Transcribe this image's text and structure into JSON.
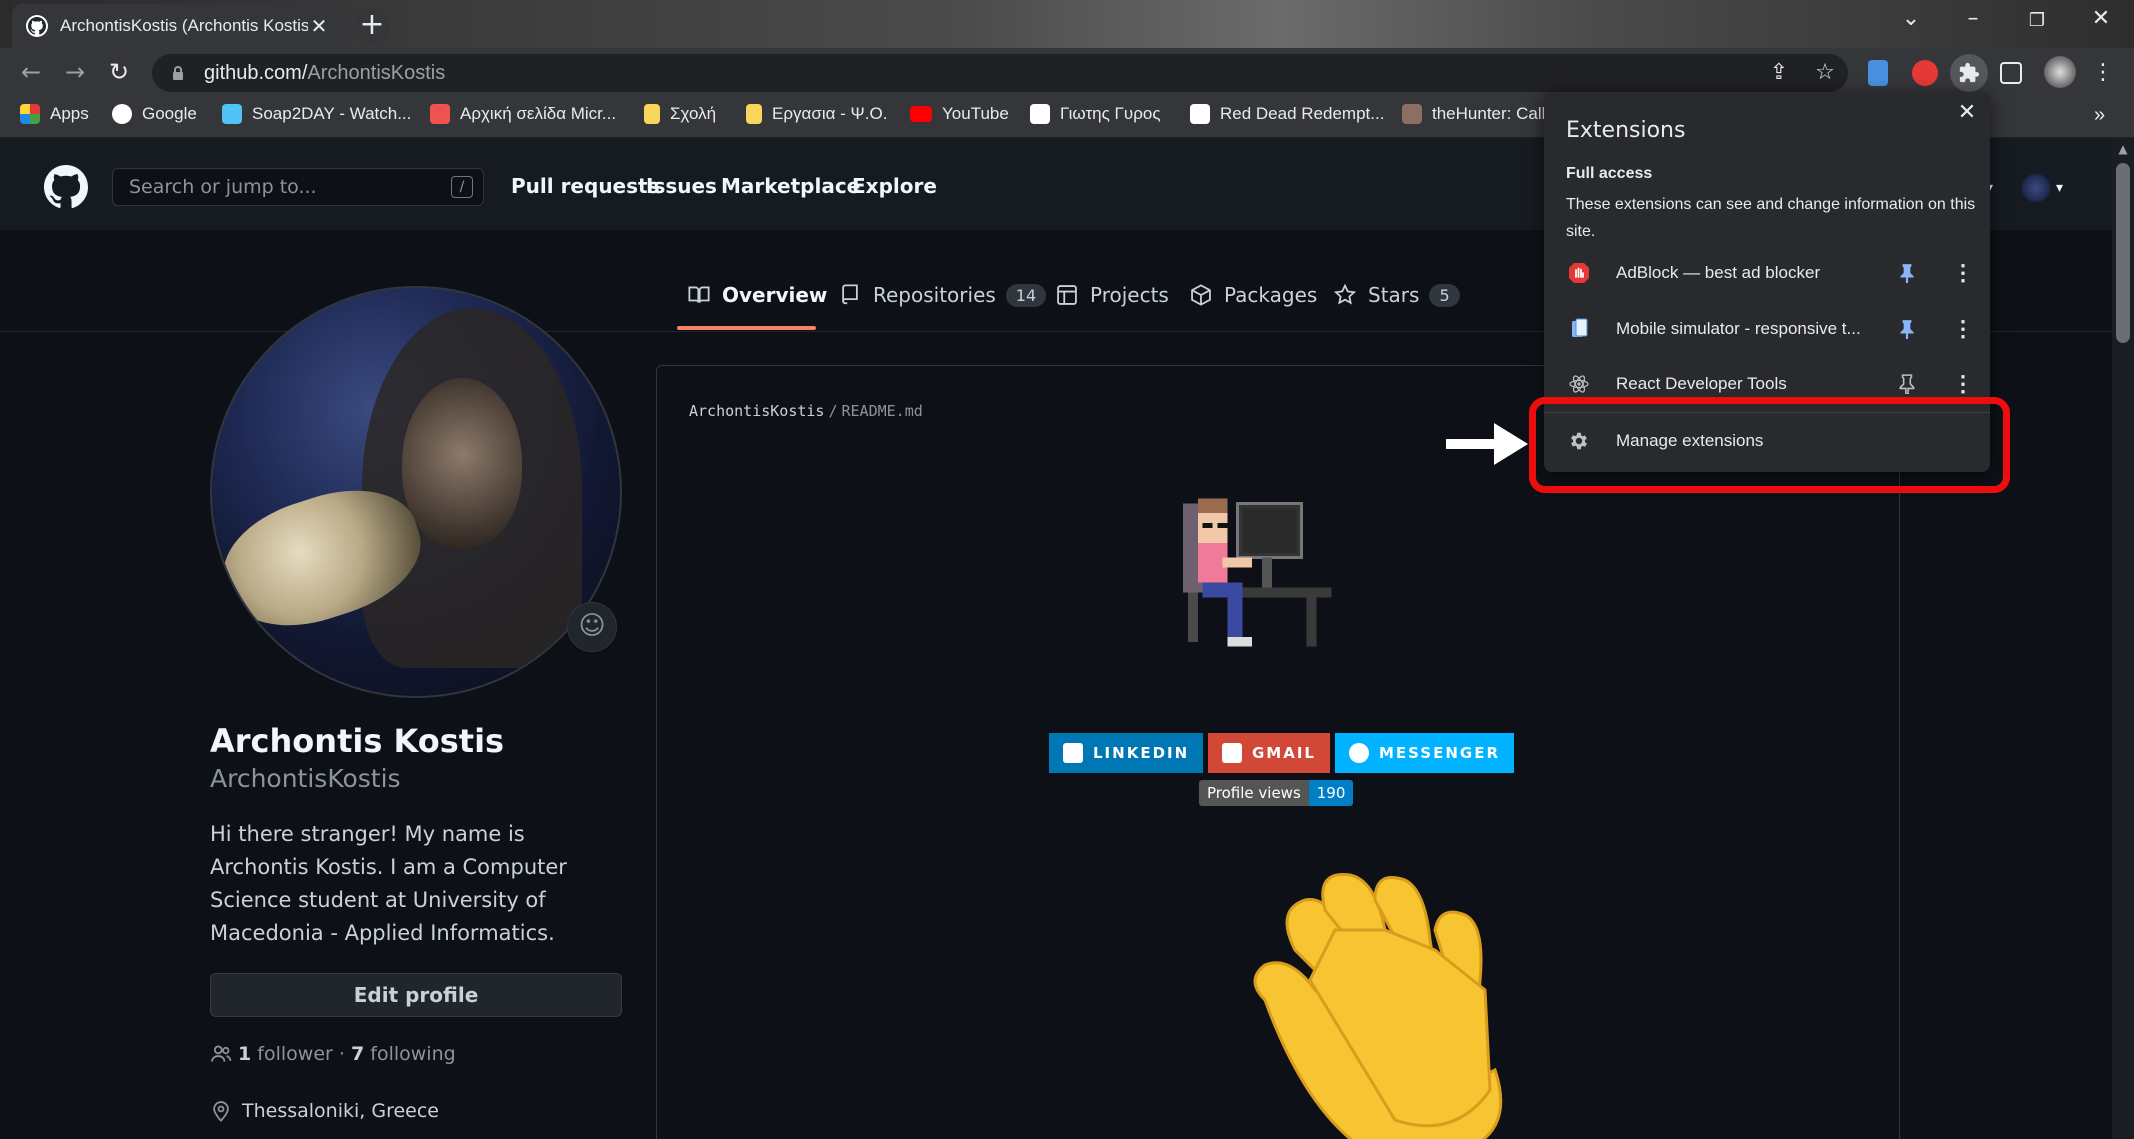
{
  "browser": {
    "tab_title": "ArchontisKostis (Archontis Kostis)",
    "tab_close": "✕",
    "new_tab": "+",
    "url_host": "github.com/",
    "url_path": "ArchontisKostis",
    "bookmarks": [
      {
        "label": "Apps",
        "color": "#e53935"
      },
      {
        "label": "Google",
        "color": "#ffffff"
      },
      {
        "label": "Soap2DAY - Watch...",
        "color": "#4fc3f7"
      },
      {
        "label": "Αρχική σελίδα Micr...",
        "color": "#ef5350"
      },
      {
        "label": "Σχολή",
        "color": "#f9d65a"
      },
      {
        "label": "Εργασια - Ψ.Ο.",
        "color": "#f9d65a"
      },
      {
        "label": "YouTube",
        "color": "#ff0000"
      },
      {
        "label": "Γιωτης Γυρος",
        "color": "#ffffff"
      },
      {
        "label": "Red Dead Redempt...",
        "color": "#ffffff"
      },
      {
        "label": "theHunter: Call",
        "color": "#8d6e63"
      }
    ],
    "bookmarks_overflow": "»"
  },
  "github": {
    "search_placeholder": "Search or jump to...",
    "search_shortcut": "/",
    "nav": [
      "Pull requests",
      "Issues",
      "Marketplace",
      "Explore"
    ],
    "tabs": [
      {
        "label": "Overview",
        "count": null
      },
      {
        "label": "Repositories",
        "count": "14"
      },
      {
        "label": "Projects",
        "count": null
      },
      {
        "label": "Packages",
        "count": null
      },
      {
        "label": "Stars",
        "count": "5"
      }
    ]
  },
  "profile": {
    "name": "Archontis Kostis",
    "login": "ArchontisKostis",
    "bio": "Hi there stranger! My name is Archontis Kostis. I am a Computer Science student at University of Macedonia - Applied Informatics.",
    "edit_button": "Edit profile",
    "followers_count": "1",
    "followers_label": "follower",
    "dot": "·",
    "following_count": "7",
    "following_label": "following",
    "location": "Thessaloniki, Greece"
  },
  "readme": {
    "owner": "ArchontisKostis",
    "separator": "/",
    "file": "README.md",
    "badges": [
      {
        "label": "LINKEDIN",
        "color": "#0077b5"
      },
      {
        "label": "GMAIL",
        "color": "#d14836"
      },
      {
        "label": "MESSENGER",
        "color": "#00b2ff"
      }
    ],
    "views_label": "Profile views",
    "views_count": "190"
  },
  "extensions_popup": {
    "title": "Extensions",
    "close": "✕",
    "section": "Full access",
    "description": "These extensions can see and change information on this site.",
    "items": [
      {
        "label": "AdBlock — best ad blocker",
        "pinned": true
      },
      {
        "label": "Mobile simulator - responsive t...",
        "pinned": true
      },
      {
        "label": "React Developer Tools",
        "pinned": false
      }
    ],
    "manage": "Manage extensions",
    "more_glyph": "⋮",
    "highlight_color": "#ee0d0d"
  }
}
